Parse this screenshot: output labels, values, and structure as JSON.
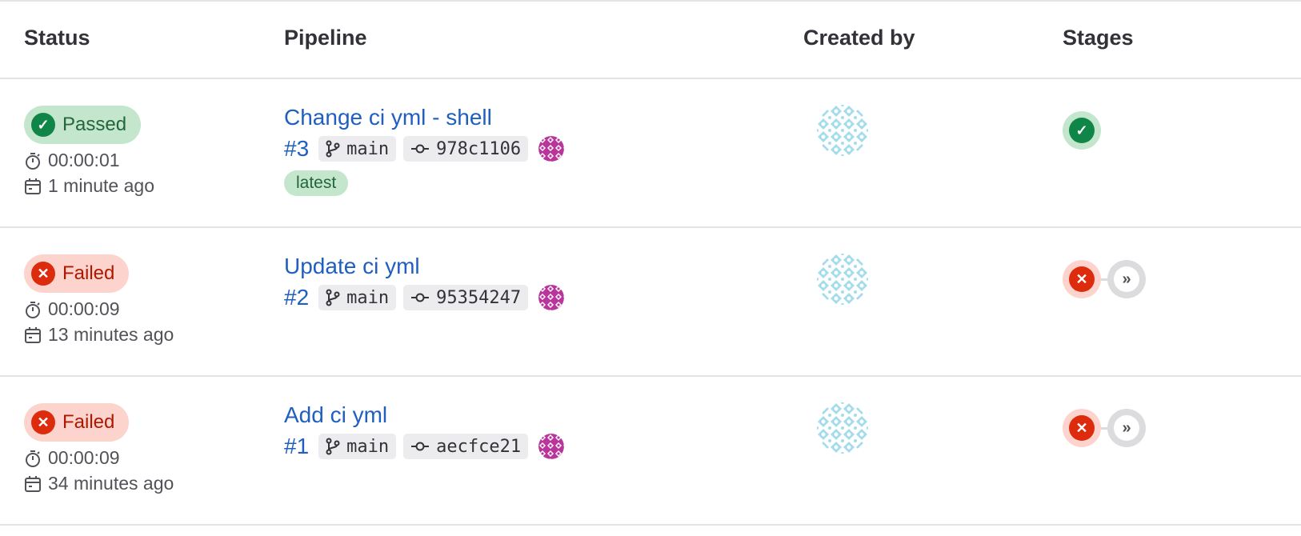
{
  "columns": {
    "status": "Status",
    "pipeline": "Pipeline",
    "created_by": "Created by",
    "stages": "Stages"
  },
  "rows": [
    {
      "status": "Passed",
      "status_kind": "passed",
      "duration": "00:00:01",
      "finished": "1 minute ago",
      "title": "Change ci yml - shell",
      "id": "#3",
      "ref": "main",
      "sha": "978c1106",
      "tag": "latest",
      "stages": [
        "success"
      ]
    },
    {
      "status": "Failed",
      "status_kind": "failed",
      "duration": "00:00:09",
      "finished": "13 minutes ago",
      "title": "Update ci yml",
      "id": "#2",
      "ref": "main",
      "sha": "95354247",
      "tag": null,
      "stages": [
        "failed",
        "skipped"
      ]
    },
    {
      "status": "Failed",
      "status_kind": "failed",
      "duration": "00:00:09",
      "finished": "34 minutes ago",
      "title": "Add ci yml",
      "id": "#1",
      "ref": "main",
      "sha": "aecfce21",
      "tag": null,
      "stages": [
        "failed",
        "skipped"
      ]
    }
  ],
  "icons": {
    "passed": "check-circle-icon",
    "failed": "x-circle-icon",
    "duration": "timer-icon",
    "finished": "calendar-icon",
    "branch": "branch-icon",
    "commit": "commit-icon",
    "skipped": "chevron-double-right-icon"
  },
  "colors": {
    "link": "#1f5fbf",
    "success": "#108548",
    "success_bg": "#c3e6cd",
    "danger": "#dd2b0e",
    "danger_bg": "#fdd4cd",
    "avatar_user": "#9fdaeb",
    "avatar_committer": "#b8359b"
  }
}
